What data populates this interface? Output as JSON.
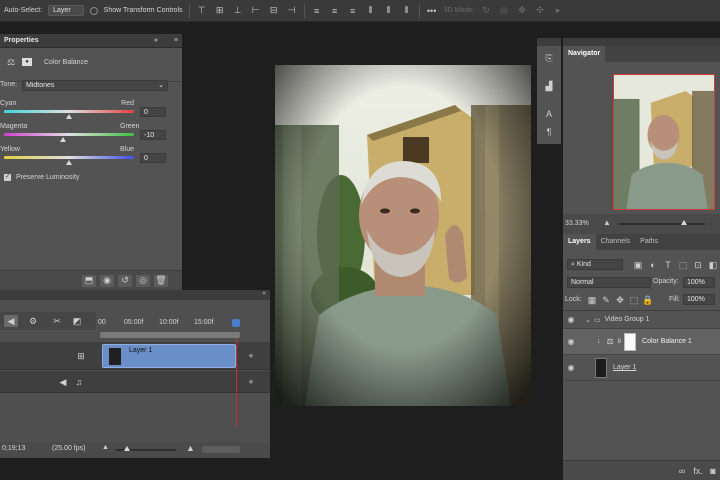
{
  "optionsbar": {
    "autoselect_label": "Auto-Select:",
    "autoselect_value": "Layer",
    "show_transform_label": "Show Transform Controls",
    "mode_3d_label": "3D Mode:"
  },
  "properties": {
    "title": "Properties",
    "adjustment_name": "Color Balance",
    "tone_label": "Tone:",
    "tone_value": "Midtones",
    "sliders": [
      {
        "left": "Cyan",
        "right": "Red",
        "value": "0",
        "level": 0
      },
      {
        "left": "Magenta",
        "right": "Green",
        "value": "-10",
        "level": -10
      },
      {
        "left": "Yellow",
        "right": "Blue",
        "value": "0",
        "level": 0
      }
    ],
    "preserve_label": "Preserve Luminosity",
    "preserve_checked": true
  },
  "timeline": {
    "ruler": [
      "00",
      "05:00f",
      "10:00f",
      "15:00f"
    ],
    "clip_label": "Layer 1",
    "timecode": "0;19;13",
    "fps": "(25.00 fps)"
  },
  "navigator": {
    "title": "Navigator",
    "zoom": "33.33%"
  },
  "layers": {
    "tabs": [
      "Layers",
      "Channels",
      "Paths"
    ],
    "kind_label": "Kind",
    "blend_mode": "Normal",
    "opacity_label": "Opacity:",
    "opacity_value": "100%",
    "lock_label": "Lock:",
    "fill_label": "Fill:",
    "fill_value": "100%",
    "rows": [
      {
        "name": "Video Group 1"
      },
      {
        "name": "Color Balance 1"
      },
      {
        "name": "Layer 1"
      }
    ]
  },
  "colors": {
    "panel_bg": "#535353",
    "dark_bg": "#1e1e1e",
    "clip_blue": "#6a8fc8",
    "playhead": "#c03030"
  }
}
